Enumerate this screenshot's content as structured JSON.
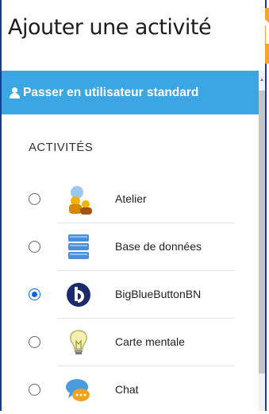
{
  "dialog": {
    "title": "Ajouter une activité"
  },
  "switch_bar": {
    "icon": "user-icon",
    "label": "Passer en utilisateur standard"
  },
  "section": {
    "label": "ACTIVITÉS"
  },
  "activities": [
    {
      "label": "Atelier",
      "icon": "workshop-icon",
      "selected": false
    },
    {
      "label": "Base de données",
      "icon": "database-icon",
      "selected": false
    },
    {
      "label": "BigBlueButtonBN",
      "icon": "bigbluebutton-icon",
      "selected": true
    },
    {
      "label": "Carte mentale",
      "icon": "lightbulb-icon",
      "selected": false
    },
    {
      "label": "Chat",
      "icon": "chat-icon",
      "selected": false
    }
  ],
  "colors": {
    "switch_bar_bg": "#3aa6e4",
    "radio_checked": "#0a62d6",
    "frame_border": "#1a3a8c",
    "background_logo": "#f7a529"
  }
}
